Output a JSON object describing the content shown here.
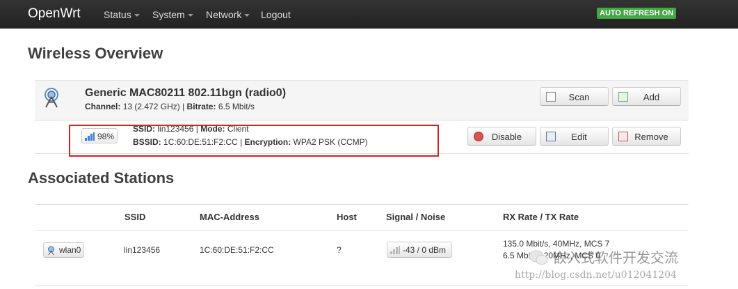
{
  "nav": {
    "brand": "OpenWrt",
    "items": [
      "Status",
      "System",
      "Network",
      "Logout"
    ],
    "auto_refresh": "AUTO REFRESH ON"
  },
  "headings": {
    "overview": "Wireless Overview",
    "stations": "Associated Stations"
  },
  "radio": {
    "title": "Generic MAC80211 802.11bgn (radio0)",
    "channel_label": "Channel:",
    "channel_value": "13 (2.472 GHz)",
    "bitrate_label": "Bitrate:",
    "bitrate_value": "6.5 Mbit/s",
    "scan": "Scan",
    "add": "Add"
  },
  "network": {
    "signal": "98%",
    "ssid_label": "SSID:",
    "ssid_value": "lin123456",
    "mode_label": "Mode:",
    "mode_value": "Client",
    "bssid_label": "BSSID:",
    "bssid_value": "1C:60:DE:51:F2:CC",
    "enc_label": "Encryption:",
    "enc_value": "WPA2 PSK (CCMP)",
    "disable": "Disable",
    "edit": "Edit",
    "remove": "Remove"
  },
  "stations": {
    "headers": [
      "SSID",
      "MAC-Address",
      "Host",
      "Signal / Noise",
      "RX Rate / TX Rate"
    ],
    "row": {
      "iface": "wlan0",
      "ssid": "lin123456",
      "mac": "1C:60:DE:51:F2:CC",
      "host": "?",
      "signal": "-43 / 0 dBm",
      "rx": "135.0 Mbit/s, 40MHz, MCS 7",
      "tx": "6.5 Mbit/s, 20MHz, MCS 0"
    }
  },
  "watermark": {
    "cn": "嵌入式软件开发交流",
    "url": "http://blog.csdn.net/u012041204"
  }
}
